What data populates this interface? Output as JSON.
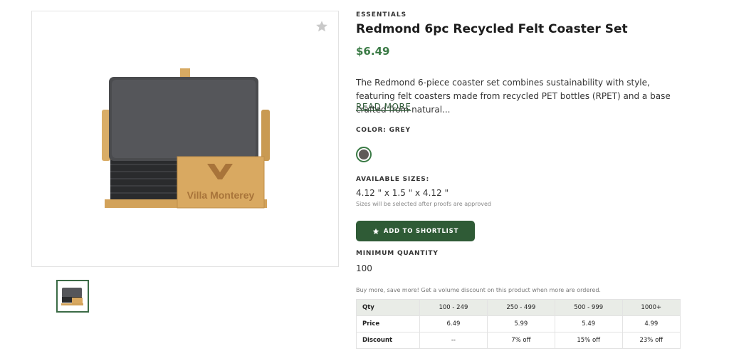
{
  "product": {
    "category": "ESSENTIALS",
    "title": "Redmond 6pc Recycled Felt Coaster Set",
    "price": "$6.49",
    "description": "The Redmond 6-piece coaster set combines sustainability with style, featuring felt coasters made from recycled PET bottles (RPET) and a base crafted from natural...",
    "read_more": "READ MORE",
    "image_brand_text": "Villa Monterey"
  },
  "color": {
    "label": "COLOR: GREY",
    "swatch_hex": "#5e5a57"
  },
  "sizes": {
    "label": "AVAILABLE SIZES:",
    "value": "4.12 \" x 1.5 \" x 4.12 \"",
    "note": "Sizes will be selected after proofs are approved"
  },
  "shortlist": {
    "label": "ADD TO SHORTLIST",
    "icon": "star-icon"
  },
  "minimum": {
    "label": "MINIMUM QUANTITY",
    "value": "100"
  },
  "pricing": {
    "note": "Buy more, save more! Get a volume discount on this product when more are ordered.",
    "header": [
      "Qty",
      "100 - 249",
      "250 - 499",
      "500 - 999",
      "1000+"
    ],
    "rows": [
      [
        "Price",
        "6.49",
        "5.99",
        "5.49",
        "4.99"
      ],
      [
        "Discount",
        "--",
        "7% off",
        "15% off",
        "23% off"
      ]
    ]
  },
  "colors": {
    "accent": "#2f5b36",
    "price": "#3a7a45"
  }
}
